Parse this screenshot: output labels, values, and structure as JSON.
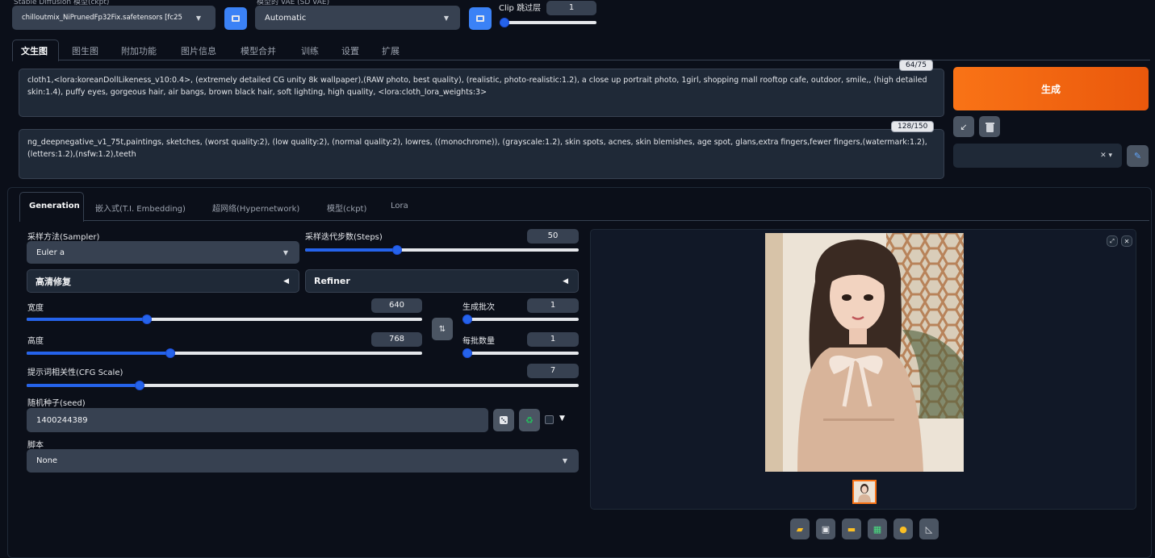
{
  "header": {
    "model_label": "Stable Diffusion 模型(ckpt)",
    "model_value": "chilloutmix_NiPrunedFp32Fix.safetensors [fc25",
    "vae_label": "模型的 VAE (SD VAE)",
    "vae_value": "Automatic",
    "clip_label": "Clip 跳过层",
    "clip_value": "1",
    "clip_level": 0.0
  },
  "main_tabs": [
    "文生图",
    "图生图",
    "附加功能",
    "图片信息",
    "模型合并",
    "训练",
    "设置",
    "扩展"
  ],
  "prompt": {
    "text": "cloth1,<lora:koreanDollLikeness_v10:0.4>, (extremely detailed CG unity 8k wallpaper),(RAW photo, best quality), (realistic, photo-realistic:1.2), a close up portrait photo, 1girl, shopping mall rooftop cafe, outdoor, smile,, (high detailed skin:1.4), puffy eyes, gorgeous hair, air bangs, brown black hair, soft lighting, high quality, <lora:cloth_lora_weights:3>",
    "counter": "64/75"
  },
  "negative_prompt": {
    "text": "ng_deepnegative_v1_75t,paintings, sketches, (worst quality:2), (low quality:2), (normal quality:2), lowres, ((monochrome)), (grayscale:1.2), skin spots, acnes, skin blemishes, age spot, glans,extra fingers,fewer fingers,(watermark:1.2),(letters:1.2),(nsfw:1.2),teeth",
    "counter": "128/150"
  },
  "generate_label": "生成",
  "sub_tabs": [
    "Generation",
    "嵌入式(T.I. Embedding)",
    "超网络(Hypernetwork)",
    "模型(ckpt)",
    "Lora"
  ],
  "sampler": {
    "label": "采样方法(Sampler)",
    "value": "Euler a"
  },
  "steps": {
    "label": "采样迭代步数(Steps)",
    "value": "50",
    "level": 0.33
  },
  "hires_label": "高清修复",
  "refiner_label": "Refiner",
  "width": {
    "label": "宽度",
    "value": "640",
    "level": 0.3
  },
  "height": {
    "label": "高度",
    "value": "768",
    "level": 0.36
  },
  "batch_count": {
    "label": "生成批次",
    "value": "1",
    "level": 0.0
  },
  "batch_size": {
    "label": "每批数量",
    "value": "1",
    "level": 0.0
  },
  "cfg": {
    "label": "提示词相关性(CFG Scale)",
    "value": "7",
    "level": 0.2
  },
  "seed": {
    "label": "随机种子(seed)",
    "value": "1400244389"
  },
  "script": {
    "label": "脚本",
    "value": "None"
  },
  "colors": {
    "accent": "#2563eb",
    "generate": "#ea580c",
    "background": "#0b0f19",
    "panel": "#1f2937"
  },
  "icons": [
    "refresh-icon",
    "arrow-down-left-icon",
    "trash-icon",
    "pencil-icon",
    "swap-icon",
    "dice-icon",
    "recycle-icon",
    "folder-icon",
    "save-icon",
    "zip-icon",
    "image-icon",
    "palette-icon",
    "ruler-icon"
  ]
}
